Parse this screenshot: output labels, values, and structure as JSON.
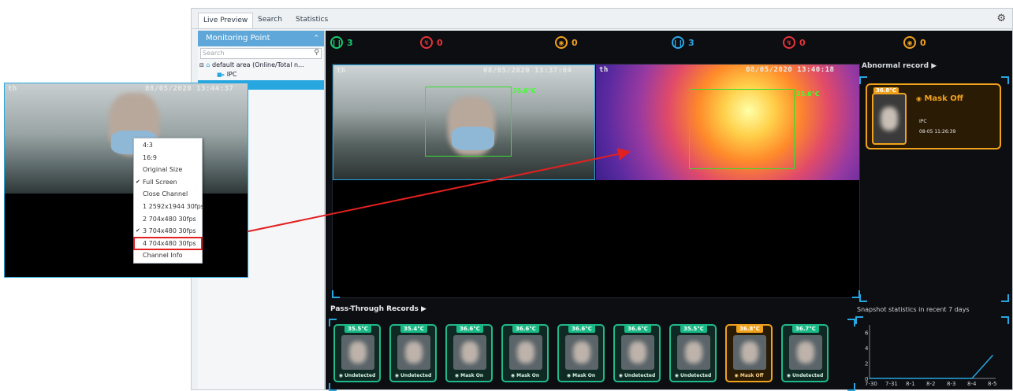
{
  "window": {
    "tabs": [
      {
        "label": "Live Preview",
        "active": true
      },
      {
        "label": "Search",
        "active": false
      },
      {
        "label": "Statistics",
        "active": false
      }
    ],
    "settings_icon": "gear-icon"
  },
  "sidebar": {
    "title": "Monitoring Point",
    "search_placeholder": "Search",
    "area_label": "default area (Online/Total n...",
    "device_label": "IPC"
  },
  "stats": [
    {
      "icon": "people-icon",
      "value": "3",
      "color": "#19c96d"
    },
    {
      "icon": "thermometer-icon",
      "value": "0",
      "color": "#e8333a"
    },
    {
      "icon": "mask-icon",
      "value": "0",
      "color": "#f1a21d"
    },
    {
      "icon": "people-icon",
      "value": "3",
      "color": "#2aa8e8"
    },
    {
      "icon": "thermometer-icon",
      "value": "0",
      "color": "#e8333a"
    },
    {
      "icon": "mask-icon",
      "value": "0",
      "color": "#f1a21d"
    }
  ],
  "video": {
    "cam_osd_left": "th",
    "cam_osd_time": "08/05/2020 13:37:04",
    "cam_face_temp": "35.6°C",
    "thermal_osd_left": "th",
    "thermal_osd_time": "08/05/2020 13:40:18",
    "thermal_face_temp": "35.6°C"
  },
  "abnormal": {
    "header": "Abnormal record",
    "temp": "36.8°C",
    "status": "Mask Off",
    "device": "IPC",
    "time": "08-05 11:26:39"
  },
  "pass_through": {
    "header": "Pass-Through Records",
    "records": [
      {
        "temp": "35.5°C",
        "status": "Undetected",
        "warn": false
      },
      {
        "temp": "35.4°C",
        "status": "Undetected",
        "warn": false
      },
      {
        "temp": "36.6°C",
        "status": "Mask On",
        "warn": false
      },
      {
        "temp": "36.6°C",
        "status": "Mask On",
        "warn": false
      },
      {
        "temp": "36.6°C",
        "status": "Mask On",
        "warn": false
      },
      {
        "temp": "36.6°C",
        "status": "Undetected",
        "warn": false
      },
      {
        "temp": "35.5°C",
        "status": "Undetected",
        "warn": false
      },
      {
        "temp": "36.8°C",
        "status": "Mask Off",
        "warn": true
      },
      {
        "temp": "36.7°C",
        "status": "Undetected",
        "warn": false
      }
    ]
  },
  "snapshot": {
    "header": "Snapshot statistics in recent 7 days"
  },
  "chart_data": {
    "type": "line",
    "categories": [
      "7-30",
      "7-31",
      "8-1",
      "8-2",
      "8-3",
      "8-4",
      "8-5"
    ],
    "series": [
      {
        "values": [
          0,
          0,
          0,
          0,
          0,
          0,
          3
        ]
      }
    ],
    "yticks": [
      0,
      2,
      4,
      6
    ],
    "ylim": [
      0,
      7
    ],
    "title": "",
    "xlabel": "",
    "ylabel": "",
    "color": "#27a6df"
  },
  "popup": {
    "osd_left": "th",
    "osd_time": "08/05/2020 13:44:37",
    "menu_items": [
      {
        "label": "4:3",
        "checked": false,
        "highlight": false
      },
      {
        "label": "16:9",
        "checked": false,
        "highlight": false
      },
      {
        "label": "Original Size",
        "checked": false,
        "highlight": false
      },
      {
        "label": "Full Screen",
        "checked": true,
        "highlight": false
      },
      {
        "label": "Close Channel",
        "checked": false,
        "highlight": false
      },
      {
        "label": "1 2592x1944 30fps",
        "checked": false,
        "highlight": false
      },
      {
        "label": "2 704x480 30fps",
        "checked": false,
        "highlight": false
      },
      {
        "label": "3 704x480 30fps",
        "checked": true,
        "highlight": false
      },
      {
        "label": "4 704x480 30fps",
        "checked": false,
        "highlight": true
      },
      {
        "label": "Channel Info",
        "checked": false,
        "highlight": false
      }
    ]
  },
  "annotation": {
    "arrow_color": "#e32020"
  }
}
